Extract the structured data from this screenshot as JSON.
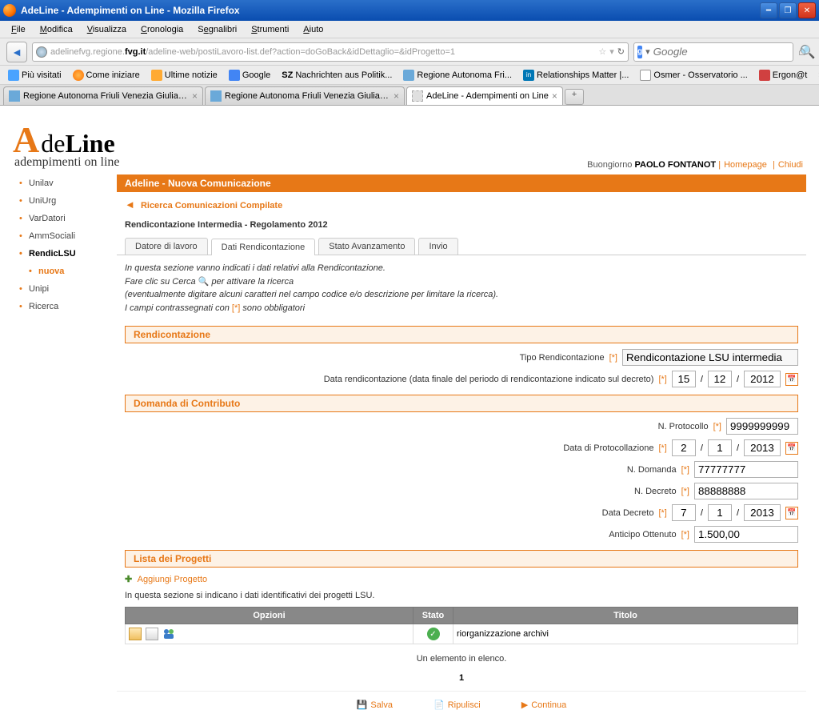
{
  "window": {
    "title": "AdeLine - Adempimenti on Line - Mozilla Firefox"
  },
  "menu": {
    "file": "File",
    "modifica": "Modifica",
    "visualizza": "Visualizza",
    "cronologia": "Cronologia",
    "segnalibri": "Segnalibri",
    "strumenti": "Strumenti",
    "aiuto": "Aiuto"
  },
  "url": {
    "gray1": "adelinefvg.regione.",
    "bold": "fvg.it",
    "gray2": "/adeline-web/postiLavoro-list.def?action=doGoBack&idDettaglio=&idProgetto=1"
  },
  "search": {
    "placeholder": "Google"
  },
  "bookmarks": [
    "Più visitati",
    "Come iniziare",
    "Ultime notizie",
    "Google",
    "Nachrichten aus Politik...",
    "Regione Autonoma Fri...",
    "Relationships Matter |...",
    "Osmer - Osservatorio ...",
    "Ergon@t"
  ],
  "tabs": {
    "t1": "Regione Autonoma Friuli Venezia Giulia - r...",
    "t2": "Regione Autonoma Friuli Venezia Giulia - r...",
    "t3": "AdeLine - Adempimenti on Line"
  },
  "brand": {
    "de": "de",
    "line": "Line",
    "sub": "adempimenti on line"
  },
  "user": {
    "greeting": "Buongiorno",
    "name": "PAOLO FONTANOT",
    "home": "Homepage",
    "close": "Chiudi"
  },
  "sidebar": {
    "unilav": "Unilav",
    "uniurg": "UniUrg",
    "vardatori": "VarDatori",
    "ammsociali": "AmmSociali",
    "rendiclsu": "RendicLSU",
    "nuova": "nuova",
    "unipi": "Unipi",
    "ricerca": "Ricerca"
  },
  "header": {
    "breadcrumb": "Adeline - Nuova Comunicazione",
    "backlink": "Ricerca Comunicazioni Compilate",
    "page_title": "Rendicontazione Intermedia - Regolamento 2012"
  },
  "subtabs": {
    "datore": "Datore di lavoro",
    "dati": "Dati Rendicontazione",
    "stato": "Stato Avanzamento",
    "invio": "Invio"
  },
  "info": {
    "line1": "In questa sezione vanno indicati i dati relativi alla Rendicontazione.",
    "line2": "Fare clic su Cerca ",
    "line2b": " per attivare la ricerca",
    "line3": "(eventualmente digitare alcuni caratteri nel campo codice e/o descrizione per limitare la ricerca).",
    "line4a": "I campi contrassegnati con ",
    "line4b": " sono obbligatori",
    "star": "[*]"
  },
  "sections": {
    "rendicontazione": "Rendicontazione",
    "domanda": "Domanda di Contributo",
    "lista": "Lista dei Progetti"
  },
  "form": {
    "tipo_label": "Tipo Rendicontazione",
    "tipo_value": "Rendicontazione LSU intermedia",
    "data_rend_label": "Data rendicontazione (data finale del periodo di rendicontazione indicato sul decreto)",
    "data_rend": {
      "d": "15",
      "m": "12",
      "y": "2012"
    },
    "nprotocollo_label": "N. Protocollo",
    "nprotocollo": "9999999999",
    "data_prot_label": "Data di Protocollazione",
    "data_prot": {
      "d": "2",
      "m": "1",
      "y": "2013"
    },
    "ndomanda_label": "N. Domanda",
    "ndomanda": "77777777",
    "ndecreto_label": "N. Decreto",
    "ndecreto": "88888888",
    "data_decreto_label": "Data Decreto",
    "data_decreto": {
      "d": "7",
      "m": "1",
      "y": "2013"
    },
    "anticipo_label": "Anticipo Ottenuto",
    "anticipo": "1.500,00"
  },
  "projects": {
    "add_link": "Aggiungi Progetto",
    "desc": "In questa sezione si indicano i dati identificativi dei progetti LSU.",
    "th_opzioni": "Opzioni",
    "th_stato": "Stato",
    "th_titolo": "Titolo",
    "row1_titolo": "riorganizzazione archivi",
    "summary": "Un elemento in elenco.",
    "page": "1"
  },
  "actions": {
    "salva": "Salva",
    "ripulisci": "Ripulisci",
    "continua": "Continua"
  }
}
